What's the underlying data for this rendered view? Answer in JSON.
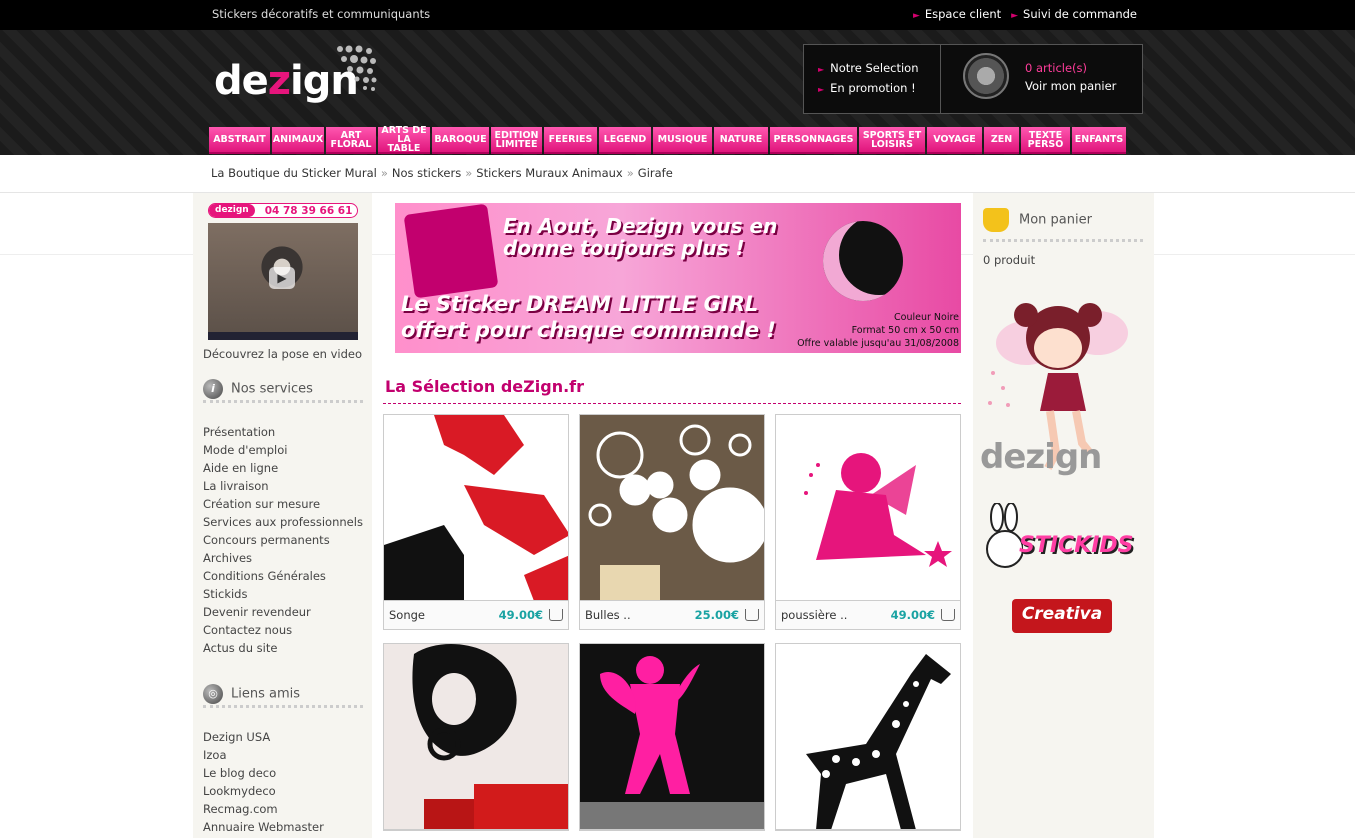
{
  "topbar": {
    "tagline": "Stickers décoratifs et communiquants",
    "links": [
      "Espace client",
      "Suivi de commande"
    ]
  },
  "logo": {
    "text_a": "de",
    "text_b": "z",
    "text_c": "ign"
  },
  "header_box": {
    "selection_links": [
      "Notre Selection",
      "En promotion !"
    ],
    "cart_count": "0 article(s)",
    "cart_link": "Voir mon panier"
  },
  "nav": [
    {
      "label": "ABSTRAIT",
      "w": 61
    },
    {
      "label": "ANIMAUX",
      "w": 52
    },
    {
      "label": "ART FLORAL",
      "w": 50
    },
    {
      "label": "ARTS DE LA TABLE",
      "w": 52
    },
    {
      "label": "BAROQUE",
      "w": 57
    },
    {
      "label": "EDITION LIMITEE",
      "w": 51
    },
    {
      "label": "FEERIES",
      "w": 53
    },
    {
      "label": "LEGEND",
      "w": 52
    },
    {
      "label": "MUSIQUE",
      "w": 59
    },
    {
      "label": "NATURE",
      "w": 54
    },
    {
      "label": "PERSONNAGES",
      "w": 87
    },
    {
      "label": "SPORTS ET LOISIRS",
      "w": 66
    },
    {
      "label": "VOYAGE",
      "w": 55
    },
    {
      "label": "ZEN",
      "w": 35
    },
    {
      "label": "TEXTE PERSO",
      "w": 49
    },
    {
      "label": "ENFANTS",
      "w": 54
    }
  ],
  "breadcrumb": [
    "La Boutique du Sticker Mural",
    "Nos stickers",
    "Stickers Muraux Animaux",
    "Girafe"
  ],
  "left": {
    "phone_brand": "dezign",
    "phone": "04 78 39 66 61",
    "video_caption": "Découvrez la pose en video",
    "services_title": "Nos services",
    "services": [
      "Présentation",
      "Mode d'emploi",
      "Aide en ligne",
      "La livraison",
      "Création sur mesure",
      "Services aux professionnels",
      "Concours permanents",
      "Archives",
      "Conditions Générales",
      "Stickids",
      "Devenir revendeur",
      "Contactez nous",
      "Actus du site"
    ],
    "links_title": "Liens amis",
    "links": [
      "Dezign USA",
      "Izoa",
      "Le blog deco",
      "Lookmydeco",
      "Recmag.com",
      "Annuaire Webmaster"
    ]
  },
  "banner": {
    "line1a": "En Aout, Dezign vous en",
    "line1b": "donne toujours plus !",
    "line2a": "Le Sticker DREAM LITTLE GIRL",
    "line2b": "offert pour chaque commande !",
    "small1": "Couleur Noire",
    "small2": "Format 50 cm x 50 cm",
    "small3": "Offre valable jusqu'au 31/08/2008"
  },
  "selection_title": "La Sélection deZign.fr",
  "products": [
    {
      "name": "Songe",
      "price": "49.00€"
    },
    {
      "name": "Bulles ..",
      "price": "25.00€"
    },
    {
      "name": "poussière ..",
      "price": "49.00€"
    }
  ],
  "right": {
    "cart_title": "Mon panier",
    "cart_items": "0 produit",
    "fairy_brand": "dezign",
    "stickids": "STICKIDS",
    "creativa": "Creativa"
  },
  "colors": {
    "accent": "#e6157c",
    "price": "#1aa3a3",
    "title": "#c2006e"
  }
}
